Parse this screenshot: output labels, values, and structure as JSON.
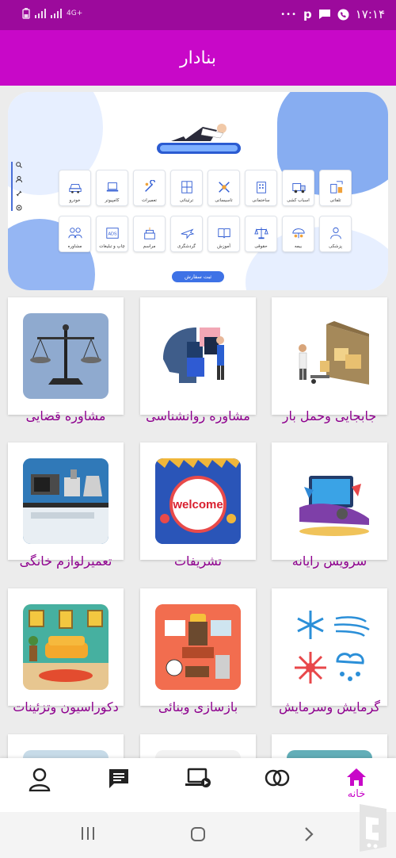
{
  "status_bar": {
    "time": "۱۷:۱۴",
    "network": "4G+",
    "p_letter": "p",
    "dots": "•••"
  },
  "app": {
    "title": "بنادار"
  },
  "banner": {
    "order_button": "ثبت سفارش",
    "categories": [
      {
        "label": "تلفاتی",
        "icon": "building-crane-icon"
      },
      {
        "label": "اسباب کشی",
        "icon": "moving-truck-icon"
      },
      {
        "label": "ساختمانی",
        "icon": "building-icon"
      },
      {
        "label": "تاسیساتی",
        "icon": "tools-icon"
      },
      {
        "label": "ترئیناتی",
        "icon": "window-decor-icon"
      },
      {
        "label": "تعمیرات",
        "icon": "wrench-icon"
      },
      {
        "label": "کامپیوتر",
        "icon": "laptop-icon"
      },
      {
        "label": "خودرو",
        "icon": "car-icon"
      },
      {
        "label": "پزشکی",
        "icon": "doctor-icon"
      },
      {
        "label": "بیمه",
        "icon": "umbrella-icon"
      },
      {
        "label": "حقوقی",
        "icon": "scales-icon"
      },
      {
        "label": "آموزش",
        "icon": "book-icon"
      },
      {
        "label": "گردشگری",
        "icon": "airplane-icon"
      },
      {
        "label": "مراسم",
        "icon": "cake-icon"
      },
      {
        "label": "چاپ و تبلیغات",
        "icon": "ads-icon"
      },
      {
        "label": "مشاوره",
        "icon": "consult-icon"
      }
    ],
    "side_icons": [
      "search-icon",
      "user-icon",
      "link-icon",
      "settings-icon"
    ]
  },
  "services": [
    {
      "label": "مشاوره قضایی",
      "icon": "scales-icon"
    },
    {
      "label": "مشاوره روانشناسی",
      "icon": "puzzle-head-icon"
    },
    {
      "label": "جابجایی وحمل بار",
      "icon": "moving-truck-icon"
    },
    {
      "label": "تعمیرلوازم خانگی",
      "icon": "appliances-icon"
    },
    {
      "label": "تشریفات",
      "icon": "welcome-sign-icon"
    },
    {
      "label": "سرویس رایانه",
      "icon": "computer-service-icon"
    },
    {
      "label": "دکوراسیون وتزئینات",
      "icon": "living-room-icon"
    },
    {
      "label": "بازسازی وبنائی",
      "icon": "construction-tools-icon"
    },
    {
      "label": "گرمایش وسرمایش",
      "icon": "heating-cooling-icon"
    }
  ],
  "welcome_sign_text": "welcome",
  "ads_text": "ADS",
  "bottom_nav": {
    "home_label": "خانه",
    "items": [
      "profile-icon",
      "messages-icon",
      "video-laptop-icon",
      "rings-icon",
      "home-icon"
    ]
  },
  "colors": {
    "status_bar": "#9c0a9c",
    "app_bar": "#c808c8",
    "label": "#8e008e",
    "accent_blue": "#3e72e6"
  }
}
